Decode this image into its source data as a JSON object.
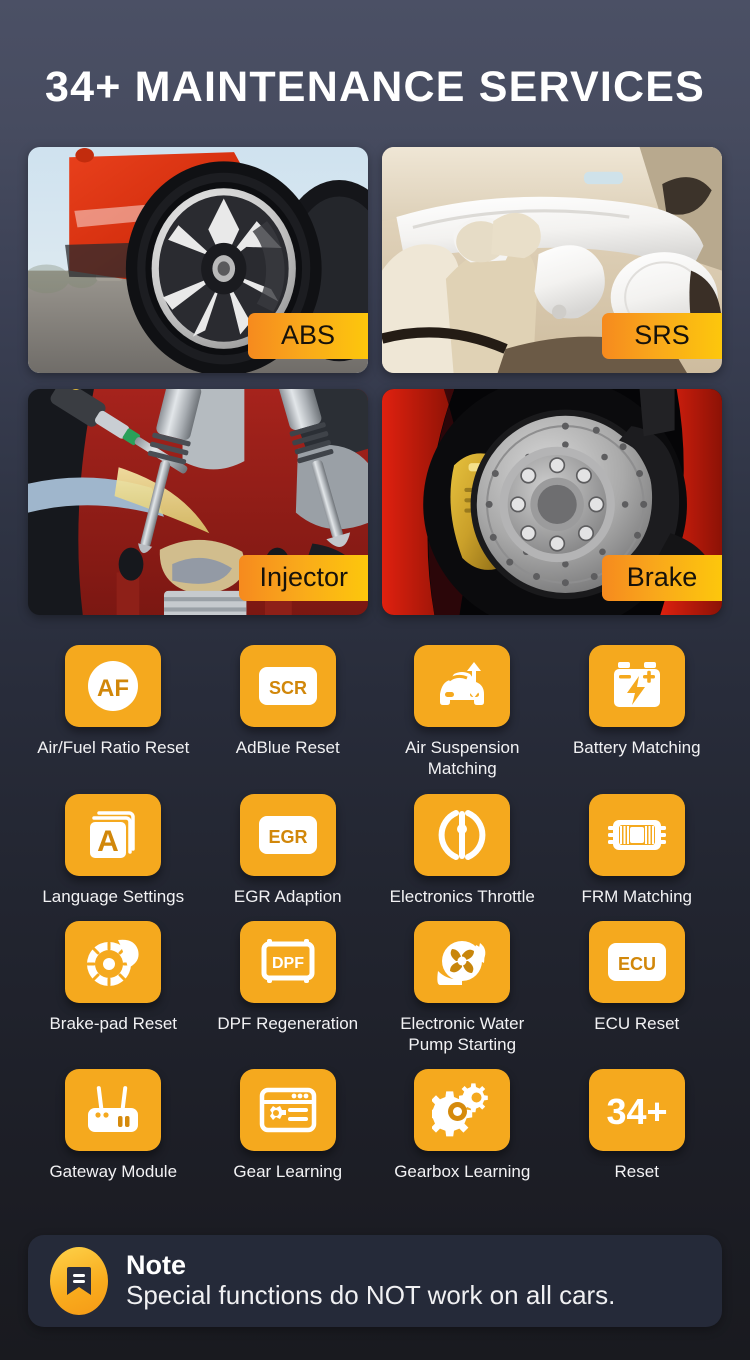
{
  "header": {
    "title": "34+ MAINTENANCE SERVICES"
  },
  "photo_cards": [
    {
      "badge": "ABS",
      "art": "car-wheel-photo",
      "name": "photo-card-abs"
    },
    {
      "badge": "SRS",
      "art": "airbag-interior-photo",
      "name": "photo-card-srs"
    },
    {
      "badge": "Injector",
      "art": "fuel-injector-photo",
      "name": "photo-card-injector"
    },
    {
      "badge": "Brake",
      "art": "brake-rotor-photo",
      "name": "photo-card-brake"
    }
  ],
  "functions": [
    {
      "label": "Air/Fuel Ratio Reset",
      "icon": "af-circle-icon",
      "text": "AF"
    },
    {
      "label": "AdBlue Reset",
      "icon": "scr-badge-icon",
      "text": "SCR"
    },
    {
      "label": "Air Suspension Matching",
      "icon": "car-suspension-icon",
      "text": ""
    },
    {
      "label": "Battery Matching",
      "icon": "battery-bolt-icon",
      "text": ""
    },
    {
      "label": "Language Settings",
      "icon": "language-a-card-icon",
      "text": "A"
    },
    {
      "label": "EGR Adaption",
      "icon": "egr-badge-icon",
      "text": "EGR"
    },
    {
      "label": "Electronics Throttle",
      "icon": "throttle-body-icon",
      "text": ""
    },
    {
      "label": "FRM Matching",
      "icon": "frm-chip-icon",
      "text": ""
    },
    {
      "label": "Brake-pad Reset",
      "icon": "brake-disc-pad-icon",
      "text": ""
    },
    {
      "label": "DPF Regeneration",
      "icon": "dpf-box-icon",
      "text": "DPF"
    },
    {
      "label": "Electronic Water Pump Starting",
      "icon": "water-pump-icon",
      "text": ""
    },
    {
      "label": "ECU Reset",
      "icon": "ecu-badge-icon",
      "text": "ECU"
    },
    {
      "label": "Gateway Module",
      "icon": "gateway-router-icon",
      "text": ""
    },
    {
      "label": "Gear Learning",
      "icon": "gear-window-icon",
      "text": ""
    },
    {
      "label": "Gearbox Learning",
      "icon": "two-gears-icon",
      "text": ""
    },
    {
      "label": "Reset",
      "icon": "count-34-plus-icon",
      "text": "34+"
    }
  ],
  "note": {
    "icon": "bookmark-note-icon",
    "title": "Note",
    "body": "Special functions do NOT work on all cars."
  },
  "colors": {
    "accent": "#f5a91e",
    "badge_gradient_start": "#f68a1e",
    "badge_gradient_end": "#fdc70c",
    "note_panel": "#252a39",
    "text": "#ffffff"
  }
}
